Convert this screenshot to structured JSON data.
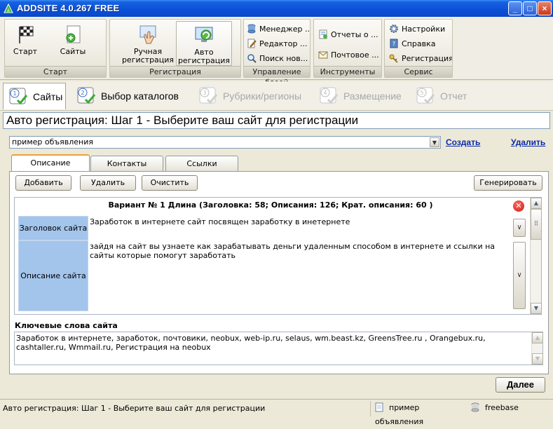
{
  "window": {
    "title": "ADDSITE 4.0.267 FREE",
    "minimize": "_",
    "maximize": "□",
    "close": "×"
  },
  "ribbon": {
    "groups": [
      {
        "caption": "Старт",
        "buttons": [
          "Старт",
          "Сайты"
        ]
      },
      {
        "caption": "Регистрация",
        "buttons": [
          "Ручная регистрация",
          "Авто регистрация"
        ]
      },
      {
        "caption": "Управление базой",
        "buttons": [
          "Менеджер ...",
          "Редактор ...",
          "Поиск нов..."
        ]
      },
      {
        "caption": "Инструменты",
        "buttons": [
          "Отчеты о ...",
          "Почтовое ..."
        ]
      },
      {
        "caption": "Сервис",
        "buttons": [
          "Настройки",
          "Справка",
          "Регистрация"
        ]
      }
    ]
  },
  "steps": [
    {
      "label": "Сайты",
      "state": "active"
    },
    {
      "label": "Выбор каталогов",
      "state": "enabled"
    },
    {
      "label": "Рубрики/регионы",
      "state": "disabled"
    },
    {
      "label": "Размещение",
      "state": "disabled"
    },
    {
      "label": "Отчет",
      "state": "disabled"
    }
  ],
  "header": {
    "title": "Авто регистрация: Шаг 1 - Выберите ваш сайт для регистрации"
  },
  "site": {
    "selected": "пример объявления",
    "create_link": "Создать",
    "delete_link": "Удалить"
  },
  "panel_tabs": [
    "Описание",
    "Контакты",
    "Ссылки"
  ],
  "toolbar": {
    "add": "Добавить",
    "delete": "Удалить",
    "clear": "Очистить",
    "generate": "Генерировать"
  },
  "variant": {
    "title": "Вариант № 1 Длина (Заголовка: 58; Описания: 126; Крат. описания: 60 )",
    "rows": [
      {
        "label": "Заголовок сайта",
        "value": "Заработок в интернете сайт посвящен заработку в инетернете"
      },
      {
        "label": "Описание сайта",
        "value": "зайдя на сайт вы узнаете как зарабатывать деньги удаленным способом в интернете и ссылки на сайты которые помогут заработать"
      }
    ]
  },
  "keywords": {
    "label": "Ключевые слова сайта",
    "value": "Заработок в интернете, заработок, почтовики, neobux, web-ip.ru, selaus, wm.beast.kz, GreensTree.ru , Orangebux.ru, cashtaller.ru, Wmmail.ru, Регистрация на neobux"
  },
  "next_button": "Далее",
  "status": {
    "text": "Авто регистрация: Шаг 1 - Выберите ваш сайт для регистрации",
    "site": "пример объявления",
    "db": "freebase"
  },
  "colors": {
    "titlebar": "#0B4FD6",
    "label_cell": "#A3C5EC",
    "link": "#0A2AA8",
    "delete_icon": "#D8281C"
  }
}
